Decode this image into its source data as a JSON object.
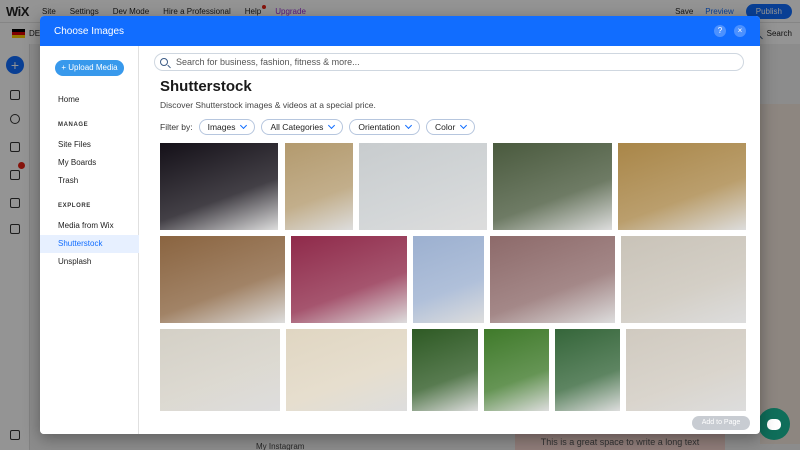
{
  "editor": {
    "logo": "WiX",
    "menu": [
      "Site",
      "Settings",
      "Dev Mode",
      "Hire a Professional",
      "Help",
      "Upgrade"
    ],
    "save": "Save",
    "preview": "Preview",
    "publish": "Publish",
    "lang": "DE",
    "search": "Search",
    "canvas_text": "This is a great space to write a long text",
    "insta": "My Instagram"
  },
  "modal": {
    "title": "Choose Images",
    "help_icon": "?",
    "close_icon": "×"
  },
  "sidebar": {
    "upload": "+ Upload Media",
    "home": "Home",
    "manage_head": "MANAGE",
    "site_files": "Site Files",
    "my_boards": "My Boards",
    "trash": "Trash",
    "explore_head": "EXPLORE",
    "media_from_wix": "Media from Wix",
    "shutterstock": "Shutterstock",
    "unsplash": "Unsplash"
  },
  "main": {
    "search_placeholder": "Search for business, fashion, fitness & more...",
    "heading": "Shutterstock",
    "subheading": "Discover Shutterstock images & videos at a special price.",
    "filter_label": "Filter by:",
    "filters": [
      "Images",
      "All Categories",
      "Orientation",
      "Color"
    ],
    "add_to_page": "Add to Page"
  },
  "thumbnails": [
    {
      "name": "dark-texture",
      "color": "#141018"
    },
    {
      "name": "rusty-car-desert",
      "color": "#b39a6e"
    },
    {
      "name": "2022-bokeh",
      "color": "#c8ccce"
    },
    {
      "name": "river-stream",
      "color": "#4a5a3e"
    },
    {
      "name": "clock-new-year",
      "color": "#a98648"
    },
    {
      "name": "party-2022-balloons",
      "color": "#8a6440"
    },
    {
      "name": "pink-rose",
      "color": "#8f2a4a"
    },
    {
      "name": "tulip-flower",
      "color": "#9cb0d0"
    },
    {
      "name": "cosmetic-bag",
      "color": "#8d6a6a"
    },
    {
      "name": "sushi-plate",
      "color": "#c9c3b8"
    },
    {
      "name": "salmon-salad",
      "color": "#d4d0c6"
    },
    {
      "name": "soup-bowl",
      "color": "#e0d6c2"
    },
    {
      "name": "orange-cocktail",
      "color": "#2e5a24"
    },
    {
      "name": "mojito",
      "color": "#3f7a2a"
    },
    {
      "name": "strawberry-milkshake",
      "color": "#35663a"
    },
    {
      "name": "sushi-rolls",
      "color": "#d0cac0"
    }
  ]
}
